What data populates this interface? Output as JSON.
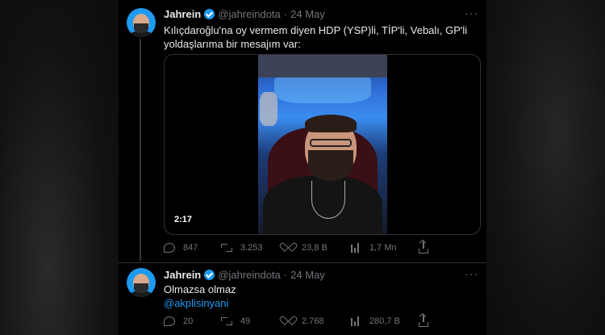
{
  "tweets": [
    {
      "author": "Jahrein",
      "handle": "@jahreindota",
      "separator": "·",
      "date": "24 May",
      "text_line1": "Kılıçdaroğlu'na oy vermem diyen HDP (YSP)li, TİP'li, Vebalı, GP'li",
      "text_line2": "yoldaşlarıma bir mesajım var:",
      "video_duration": "2:17",
      "replies": "847",
      "retweets": "3.253",
      "likes": "23,8 B",
      "views": "1,7 Mn",
      "more": "···"
    },
    {
      "author": "Jahrein",
      "handle": "@jahreindota",
      "separator": "·",
      "date": "24 May",
      "text_line1": "Olmazsa olmaz",
      "mention": "@akplisinyani",
      "replies": "20",
      "retweets": "49",
      "likes": "2.768",
      "views": "280,7 B",
      "more": "···"
    }
  ],
  "colors": {
    "accent": "#1d9bf0",
    "text": "#e7e9ea",
    "muted": "#71767b",
    "background": "#000000"
  }
}
